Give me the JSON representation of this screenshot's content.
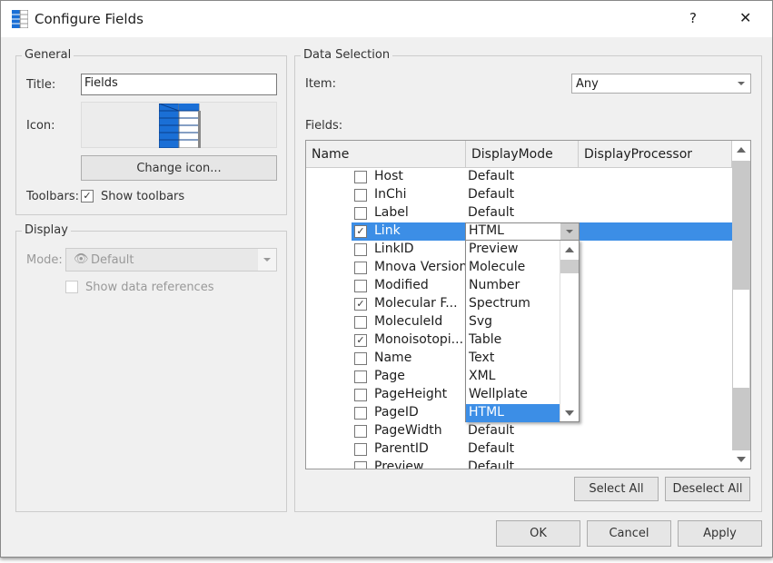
{
  "window": {
    "title": "Configure Fields",
    "help_label": "?",
    "close_label": "✕"
  },
  "general": {
    "legend": "General",
    "title_label": "Title:",
    "title_value": "Fields",
    "icon_label": "Icon:",
    "change_icon": "Change icon...",
    "toolbars_label": "Toolbars:",
    "show_toolbars": "Show toolbars",
    "show_toolbars_checked": true
  },
  "display": {
    "legend": "Display",
    "mode_label": "Mode:",
    "mode_value": "Default",
    "show_refs": "Show data references",
    "show_refs_checked": false
  },
  "data_selection": {
    "legend": "Data Selection",
    "item_label": "Item:",
    "item_value": "Any",
    "fields_label": "Fields:"
  },
  "table": {
    "columns": [
      "Name",
      "DisplayMode",
      "DisplayProcessor"
    ],
    "rows": [
      {
        "name": "Host",
        "checked": false,
        "mode": "Default"
      },
      {
        "name": "InChi",
        "checked": false,
        "mode": "Default"
      },
      {
        "name": "Label",
        "checked": false,
        "mode": "Default"
      },
      {
        "name": "Link",
        "checked": true,
        "mode": "HTML",
        "selected": true
      },
      {
        "name": "LinkID",
        "checked": false,
        "mode": ""
      },
      {
        "name": "Mnova Version",
        "checked": false,
        "mode": ""
      },
      {
        "name": "Modified",
        "checked": false,
        "mode": ""
      },
      {
        "name": "Molecular F...",
        "checked": true,
        "mode": ""
      },
      {
        "name": "MoleculeId",
        "checked": false,
        "mode": ""
      },
      {
        "name": "Monoisotopi...",
        "checked": true,
        "mode": ""
      },
      {
        "name": "Name",
        "checked": false,
        "mode": ""
      },
      {
        "name": "Page",
        "checked": false,
        "mode": ""
      },
      {
        "name": "PageHeight",
        "checked": false,
        "mode": ""
      },
      {
        "name": "PageID",
        "checked": false,
        "mode": ""
      },
      {
        "name": "PageWidth",
        "checked": false,
        "mode": "Default"
      },
      {
        "name": "ParentID",
        "checked": false,
        "mode": "Default"
      },
      {
        "name": "Preview",
        "checked": false,
        "mode": "Default"
      }
    ]
  },
  "dropdown": {
    "options": [
      "Preview",
      "Molecule",
      "Number",
      "Spectrum",
      "Svg",
      "Table",
      "Text",
      "XML",
      "Wellplate",
      "HTML"
    ],
    "selected": "HTML"
  },
  "buttons": {
    "select_all": "Select All",
    "deselect_all": "Deselect All",
    "ok": "OK",
    "cancel": "Cancel",
    "apply": "Apply"
  },
  "colors": {
    "selection": "#3c8ee6",
    "icon_blue": "#1a6fd6"
  }
}
